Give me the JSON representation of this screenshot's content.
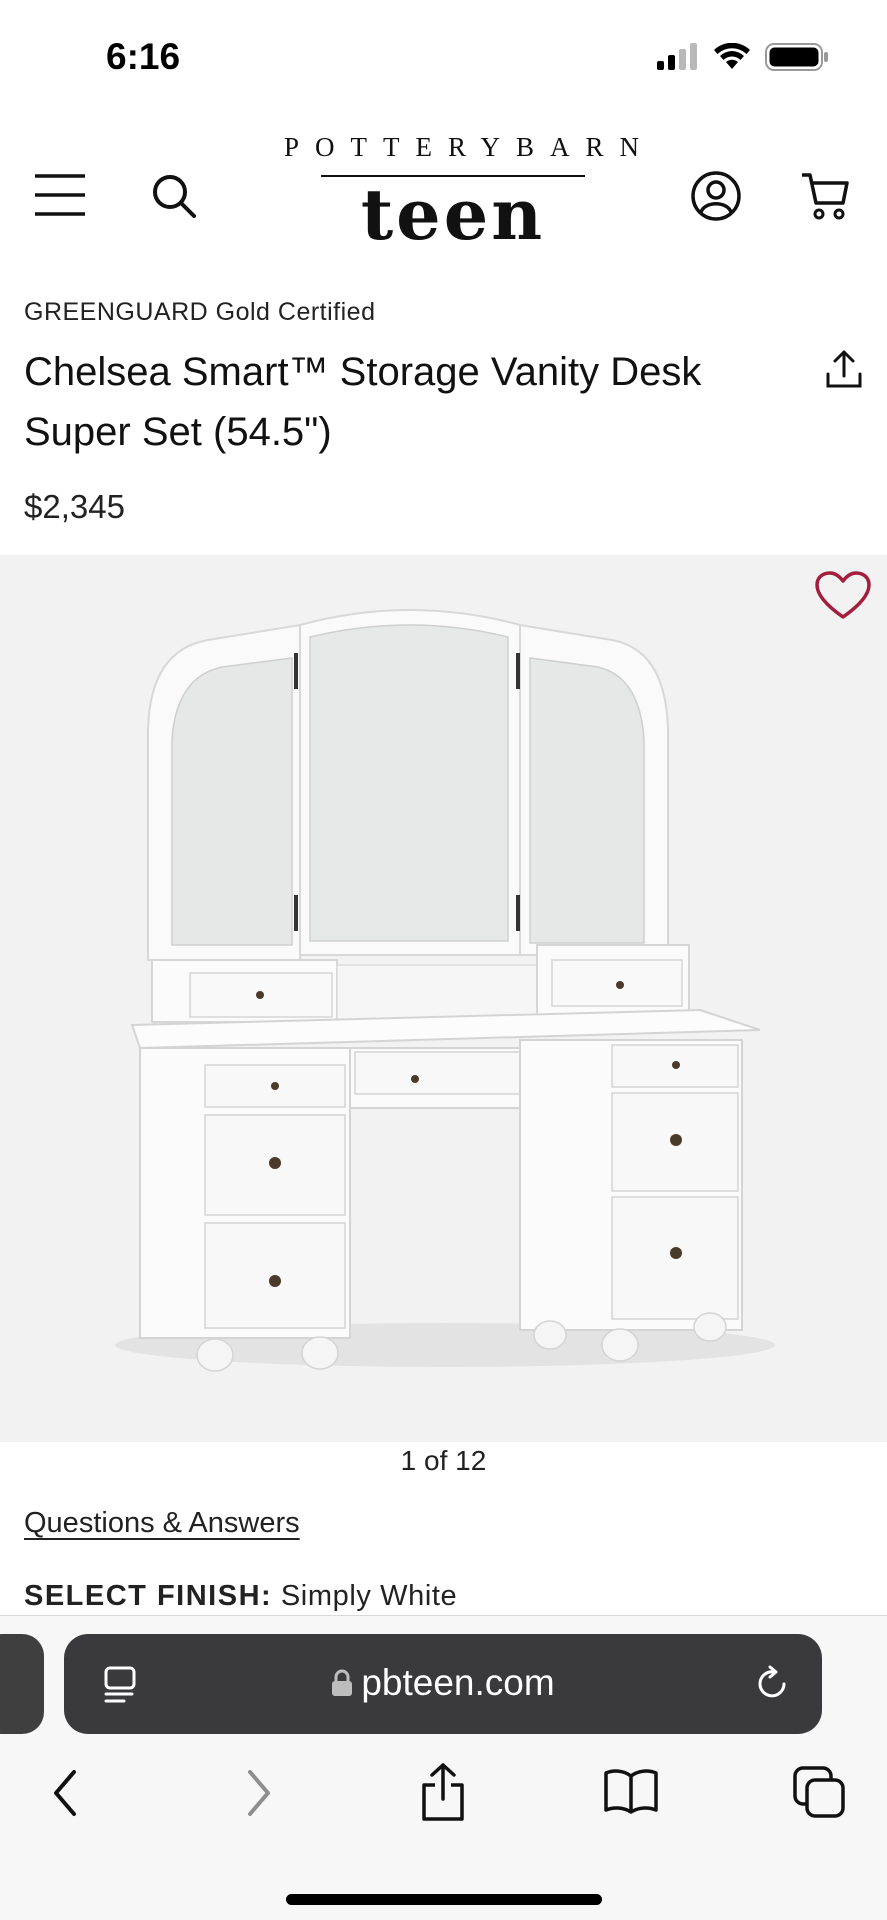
{
  "status_bar": {
    "time": "6:16",
    "icons": [
      "cellular-signal-icon",
      "wifi-icon",
      "battery-icon"
    ]
  },
  "header": {
    "logo_top": "POTTERYBARN",
    "logo_bottom": "teen",
    "icons": [
      "menu-icon",
      "search-icon",
      "account-icon",
      "cart-icon"
    ]
  },
  "product": {
    "certification": "GREENGUARD Gold Certified",
    "title": "Chelsea Smart™ Storage Vanity Desk Super Set (54.5\")",
    "price": "$2,345",
    "image_counter": "1 of 12",
    "qa_link": "Questions & Answers",
    "finish_label": "SELECT FINISH:",
    "finish_value": "Simply White"
  },
  "colors": {
    "favorite_heart": "#a31d3c",
    "gallery_bg": "#f2f2f2",
    "address_bar_bg": "#3a3a3c"
  },
  "browser": {
    "url": "pbteen.com",
    "icons": [
      "tab-overview-icon",
      "lock-icon",
      "reload-icon",
      "back-icon",
      "forward-icon",
      "share-icon",
      "bookmarks-icon",
      "tabs-icon"
    ]
  }
}
